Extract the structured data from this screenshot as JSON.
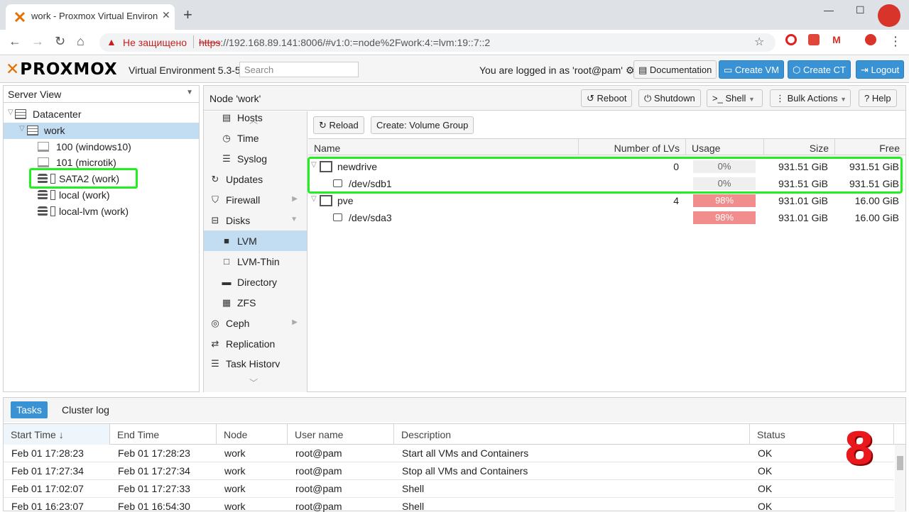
{
  "browser": {
    "tab_title": "work - Proxmox Virtual Environm",
    "not_secure": "Не защищено",
    "url_scheme": "https",
    "url_rest": "://192.168.89.141:8006/#v1:0:=node%2Fwork:4:=lvm:19::7::2"
  },
  "header": {
    "version": "Virtual Environment 5.3-5",
    "search_placeholder": "Search",
    "logged_in": "You are logged in as 'root@pam'",
    "buttons": {
      "documentation": "Documentation",
      "create_vm": "Create VM",
      "create_ct": "Create CT",
      "logout": "Logout"
    }
  },
  "tree": {
    "view": "Server View",
    "items": [
      {
        "label": "Datacenter"
      },
      {
        "label": "work"
      },
      {
        "label": "100 (windows10)"
      },
      {
        "label": "101 (microtik)"
      },
      {
        "label": "SATA2 (work)"
      },
      {
        "label": "local (work)"
      },
      {
        "label": "local-lvm (work)"
      }
    ]
  },
  "node": {
    "title": "Node 'work'",
    "buttons": {
      "reboot": "Reboot",
      "shutdown": "Shutdown",
      "shell": "Shell",
      "bulk": "Bulk Actions",
      "help": "Help"
    }
  },
  "menu": [
    {
      "label": "Hosts",
      "icon": "hosts-icon"
    },
    {
      "label": "Time",
      "icon": "clock-icon"
    },
    {
      "label": "Syslog",
      "icon": "list-icon"
    },
    {
      "label": "Updates",
      "icon": "refresh-icon"
    },
    {
      "label": "Firewall",
      "icon": "shield-icon"
    },
    {
      "label": "Disks",
      "icon": "disk-icon"
    },
    {
      "label": "LVM",
      "icon": "square-icon"
    },
    {
      "label": "LVM-Thin",
      "icon": "square-outline-icon"
    },
    {
      "label": "Directory",
      "icon": "folder-icon"
    },
    {
      "label": "ZFS",
      "icon": "grid-icon"
    },
    {
      "label": "Ceph",
      "icon": "ceph-icon"
    },
    {
      "label": "Replication",
      "icon": "retweet-icon"
    },
    {
      "label": "Task History",
      "icon": "list-icon"
    }
  ],
  "content": {
    "reload": "Reload",
    "create_vg": "Create: Volume Group",
    "columns": [
      "Name",
      "Number of LVs",
      "Usage",
      "Size",
      "Free"
    ],
    "rows": [
      {
        "name": "newdrive",
        "lvs": "0",
        "usage": "0%",
        "usage_level": 0,
        "size": "931.51 GiB",
        "free": "931.51 GiB"
      },
      {
        "name": "/dev/sdb1",
        "lvs": "",
        "usage": "0%",
        "usage_level": 0,
        "size": "931.51 GiB",
        "free": "931.51 GiB"
      },
      {
        "name": "pve",
        "lvs": "4",
        "usage": "98%",
        "usage_level": 98,
        "size": "931.01 GiB",
        "free": "16.00 GiB"
      },
      {
        "name": "/dev/sda3",
        "lvs": "",
        "usage": "98%",
        "usage_level": 98,
        "size": "931.01 GiB",
        "free": "16.00 GiB"
      }
    ]
  },
  "bottom": {
    "tabs": [
      "Tasks",
      "Cluster log"
    ],
    "columns": [
      "Start Time",
      "End Time",
      "Node",
      "User name",
      "Description",
      "Status"
    ],
    "rows": [
      [
        "Feb 01 17:28:23",
        "Feb 01 17:28:23",
        "work",
        "root@pam",
        "Start all VMs and Containers",
        "OK"
      ],
      [
        "Feb 01 17:27:34",
        "Feb 01 17:27:34",
        "work",
        "root@pam",
        "Stop all VMs and Containers",
        "OK"
      ],
      [
        "Feb 01 17:02:07",
        "Feb 01 17:27:33",
        "work",
        "root@pam",
        "Shell",
        "OK"
      ],
      [
        "Feb 01 16:23:07",
        "Feb 01 16:54:30",
        "work",
        "root@pam",
        "Shell",
        "OK"
      ]
    ]
  },
  "annotation": {
    "number": "8"
  },
  "colors": {
    "accent": "#3892d4",
    "selection": "#c2ddf2",
    "usage_high": "#f18d8d",
    "highlight": "#22ee22",
    "annotation": "#e8181d"
  }
}
